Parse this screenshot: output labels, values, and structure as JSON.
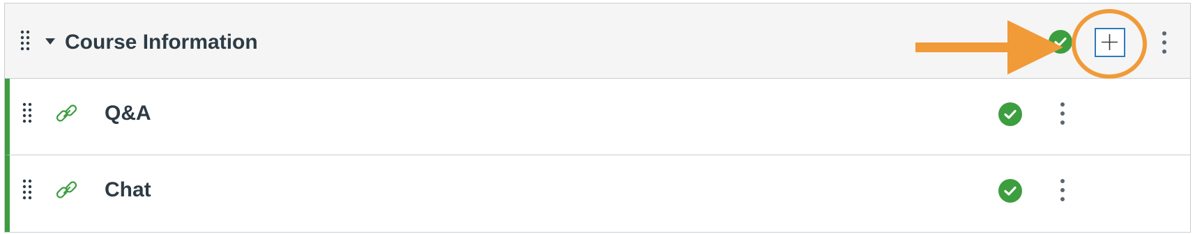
{
  "module": {
    "title": "Course Information",
    "collapse_icon": "caret-down-icon",
    "drag_icon": "drag-handle-icon",
    "status_icon": "published-check-icon",
    "add_icon": "plus-icon",
    "menu_icon": "kebab-menu-icon",
    "items": [
      {
        "title": "Q&A",
        "type_icon": "link-icon",
        "status_icon": "published-check-icon",
        "menu_icon": "kebab-menu-icon"
      },
      {
        "title": "Chat",
        "type_icon": "link-icon",
        "status_icon": "published-check-icon",
        "menu_icon": "kebab-menu-icon"
      }
    ]
  },
  "annotation": {
    "arrow_icon": "arrow-right-icon",
    "highlight": "circle-highlight"
  },
  "colors": {
    "published_green": "#3c9e3e",
    "header_bg": "#f5f5f5",
    "text_dark": "#2d3b45",
    "add_button_blue": "#2b7abc",
    "annotation_orange": "#f19a38",
    "border_gray": "#c7cdd1"
  }
}
